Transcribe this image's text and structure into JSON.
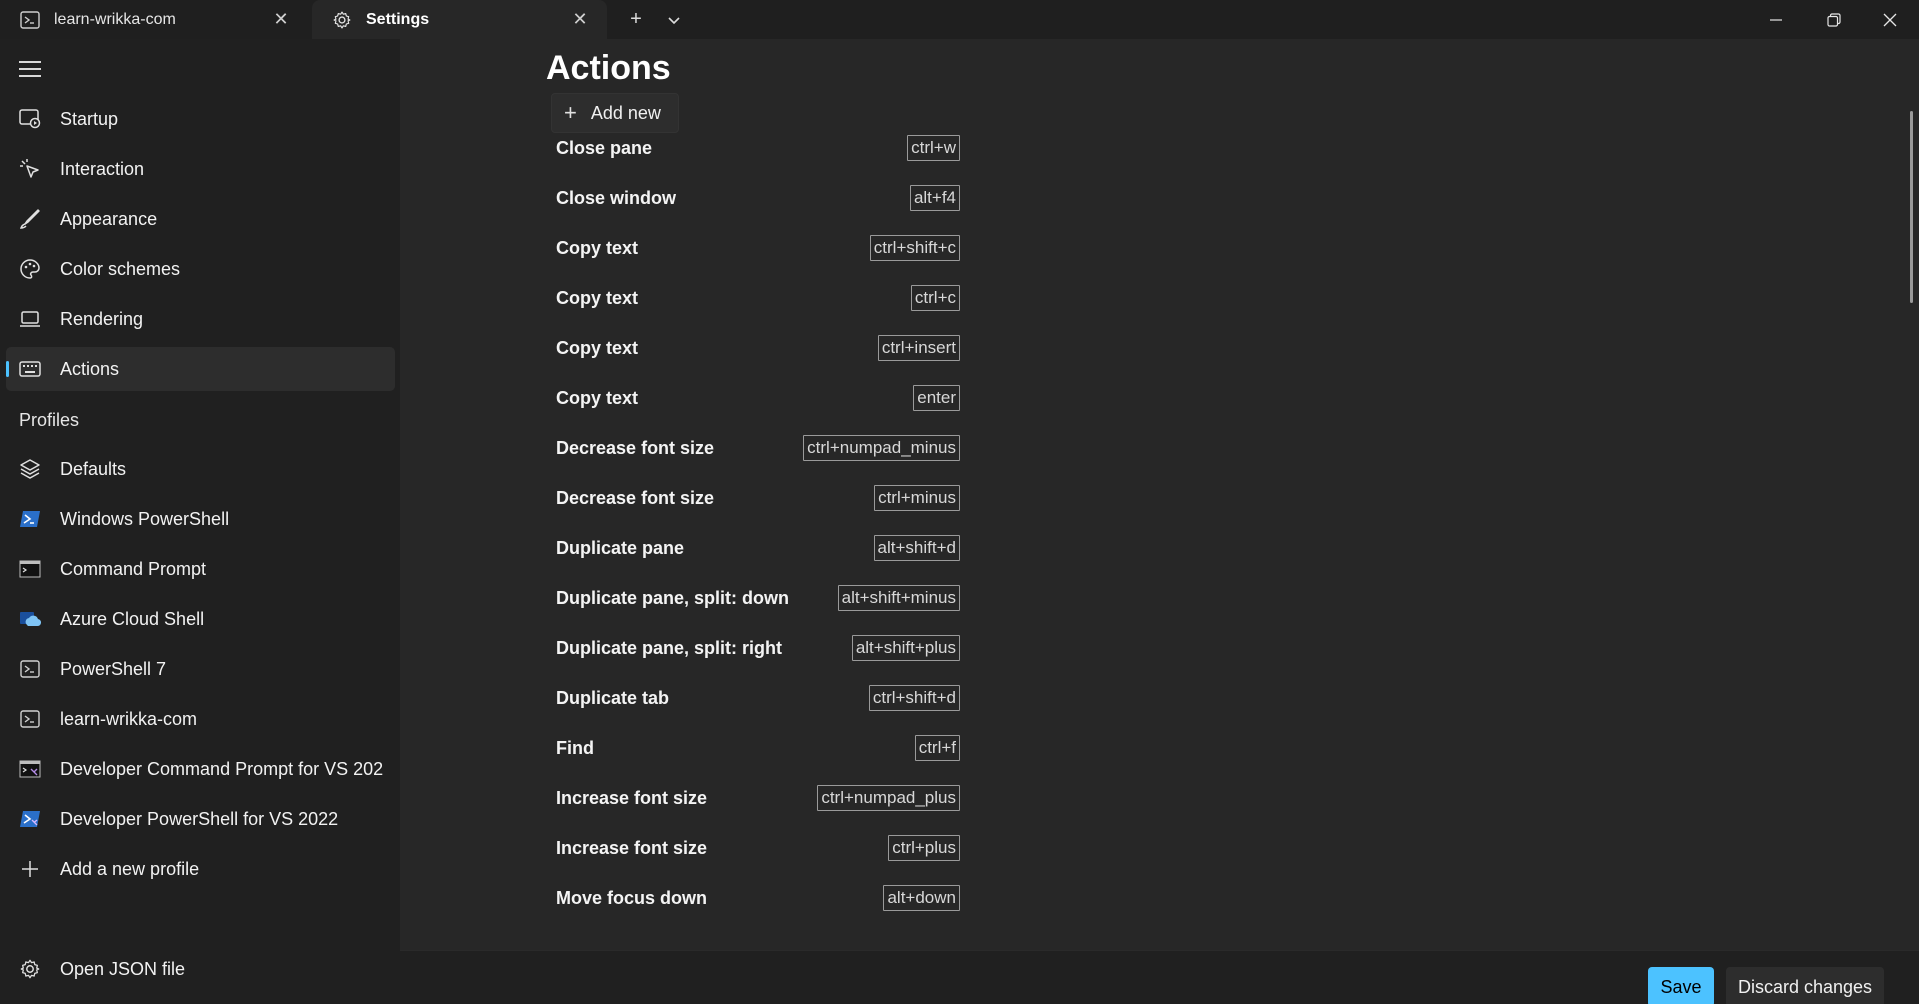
{
  "tabs": [
    {
      "label": "learn-wrikka-com",
      "icon": "terminal-icon"
    },
    {
      "label": "Settings",
      "icon": "gear-icon"
    }
  ],
  "sidebar": {
    "items": [
      {
        "label": "Startup",
        "icon": "startup-icon",
        "selected": false
      },
      {
        "label": "Interaction",
        "icon": "cursor-icon",
        "selected": false
      },
      {
        "label": "Appearance",
        "icon": "brush-icon",
        "selected": false
      },
      {
        "label": "Color schemes",
        "icon": "palette-icon",
        "selected": false
      },
      {
        "label": "Rendering",
        "icon": "laptop-icon",
        "selected": false
      },
      {
        "label": "Actions",
        "icon": "keyboard-icon",
        "selected": true
      }
    ],
    "profiles_label": "Profiles",
    "profiles": [
      {
        "label": "Defaults",
        "icon": "layers-icon"
      },
      {
        "label": "Windows PowerShell",
        "icon": "powershell-icon"
      },
      {
        "label": "Command Prompt",
        "icon": "cmd-icon"
      },
      {
        "label": "Azure Cloud Shell",
        "icon": "azure-icon"
      },
      {
        "label": "PowerShell 7",
        "icon": "terminal-icon"
      },
      {
        "label": "learn-wrikka-com",
        "icon": "terminal-icon"
      },
      {
        "label": "Developer Command Prompt for VS 202",
        "icon": "dev-cmd-icon"
      },
      {
        "label": "Developer PowerShell for VS 2022",
        "icon": "dev-powershell-icon"
      }
    ],
    "add_profile_label": "Add a new profile",
    "open_json_label": "Open JSON file"
  },
  "main": {
    "title": "Actions",
    "add_new_label": "Add new",
    "actions": [
      {
        "name": "Close pane",
        "keys": "ctrl+w"
      },
      {
        "name": "Close window",
        "keys": "alt+f4"
      },
      {
        "name": "Copy text",
        "keys": "ctrl+shift+c"
      },
      {
        "name": "Copy text",
        "keys": "ctrl+c"
      },
      {
        "name": "Copy text",
        "keys": "ctrl+insert"
      },
      {
        "name": "Copy text",
        "keys": "enter"
      },
      {
        "name": "Decrease font size",
        "keys": "ctrl+numpad_minus"
      },
      {
        "name": "Decrease font size",
        "keys": "ctrl+minus"
      },
      {
        "name": "Duplicate pane",
        "keys": "alt+shift+d"
      },
      {
        "name": "Duplicate pane, split: down",
        "keys": "alt+shift+minus"
      },
      {
        "name": "Duplicate pane, split: right",
        "keys": "alt+shift+plus"
      },
      {
        "name": "Duplicate tab",
        "keys": "ctrl+shift+d"
      },
      {
        "name": "Find",
        "keys": "ctrl+f"
      },
      {
        "name": "Increase font size",
        "keys": "ctrl+numpad_plus"
      },
      {
        "name": "Increase font size",
        "keys": "ctrl+plus"
      },
      {
        "name": "Move focus down",
        "keys": "alt+down"
      }
    ]
  },
  "footer": {
    "save_label": "Save",
    "discard_label": "Discard changes"
  },
  "colors": {
    "accent": "#4cc2ff",
    "background": "#272727",
    "sidebar": "#202020"
  }
}
